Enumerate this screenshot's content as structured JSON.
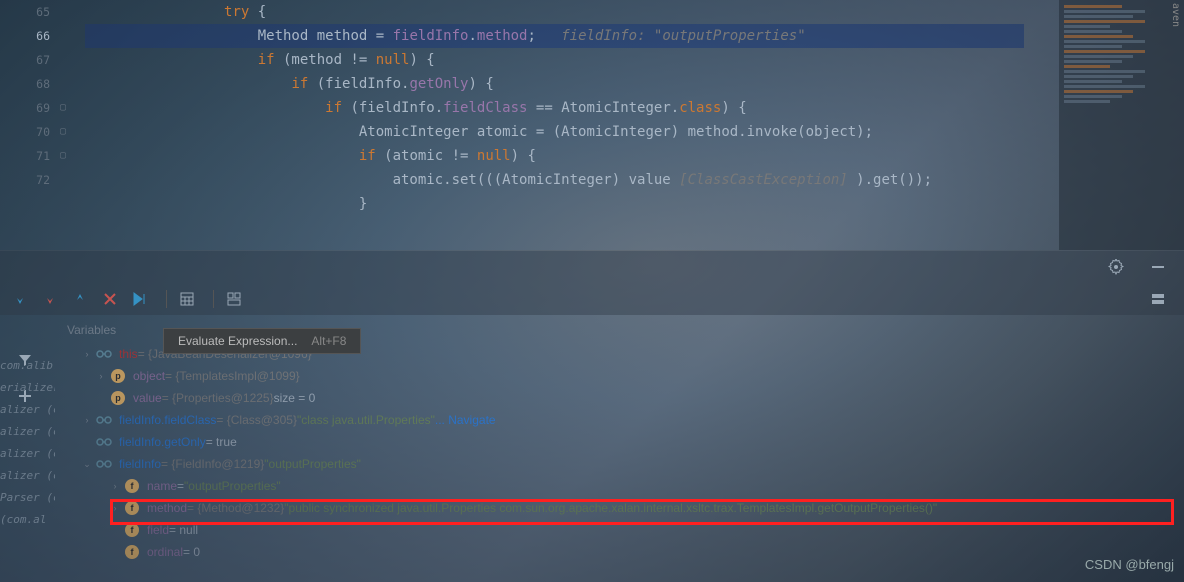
{
  "sidebar_label": "aven",
  "code": {
    "lines": [
      {
        "n": 65
      },
      {
        "n": 66,
        "current": true
      },
      {
        "n": 67
      },
      {
        "n": 68
      },
      {
        "n": 69
      },
      {
        "n": 70
      },
      {
        "n": 71
      },
      {
        "n": 72
      }
    ],
    "l65_try": "try",
    "l66_type": "Method",
    "l66_var": "method",
    "l66_eq": " = ",
    "l66_obj": "fieldInfo",
    "l66_dot": ".",
    "l66_prop": "method",
    "l66_semi": ";",
    "l66_hint": "fieldInfo: \"outputProperties\"",
    "l67_if": "if",
    "l67_cond_open": " (method != ",
    "l67_null": "null",
    "l67_close": ") {",
    "l68_if": "if",
    "l68_open": " (fieldInfo.",
    "l68_prop": "getOnly",
    "l68_close": ") {",
    "l69_if": "if",
    "l69_open": " (fieldInfo.",
    "l69_prop": "fieldClass",
    "l69_eq": " == ",
    "l69_class": "AtomicInteger",
    "l69_dot": ".",
    "l69_kw": "class",
    "l69_close": ") {",
    "l70_type": "AtomicInteger",
    "l70_var": " atomic = (",
    "l70_cast": "AtomicInteger",
    "l70_close": ") method.invoke(object);",
    "l71_if": "if",
    "l71_open": " (atomic != ",
    "l71_null": "null",
    "l71_close": ") {",
    "l72_call": "atomic.set(((AtomicInteger) value ",
    "l72_hint": "[ClassCastException]",
    "l72_close2": " ).get());"
  },
  "tooltip": {
    "label": "Evaluate Expression...",
    "shortcut": "Alt+F8"
  },
  "debugger": {
    "panel_title": "Variables",
    "rows": {
      "this_name": "this",
      "this_trail": " = {JavaBeanDeserializer@1096}",
      "object_name": "object",
      "object_val": " = {TemplatesImpl@1099}",
      "value_name": "value",
      "value_val": " = {Properties@1225}",
      "value_size": "  size = 0",
      "fc_name": "fieldInfo.fieldClass",
      "fc_val": " = {Class@305} ",
      "fc_str": "\"class java.util.Properties\"",
      "fc_nav": " ... Navigate",
      "go_name": "fieldInfo.getOnly",
      "go_val": " = true",
      "fi_name": "fieldInfo",
      "fi_val": " = {FieldInfo@1219} ",
      "fi_str": "\"outputProperties\"",
      "name_name": "name",
      "name_val": " = ",
      "name_str": "\"outputProperties\"",
      "method_name": "method",
      "method_val": " = {Method@1232} ",
      "method_str": "\"public synchronized java.util.Properties com.sun.org.apache.xalan.internal.xsltc.trax.TemplatesImpl.getOutputProperties()\"",
      "field_name": "field",
      "field_val": " = null",
      "ordinal_name": "ordinal",
      "ordinal_val": " = 0"
    }
  },
  "side_labels": [
    "com.alib.",
    "erializer",
    "alizer (c",
    "alizer (c",
    "alizer (c",
    "alizer (c",
    "Parser (c",
    "(com.al"
  ],
  "watermark": "CSDN @bfengj"
}
